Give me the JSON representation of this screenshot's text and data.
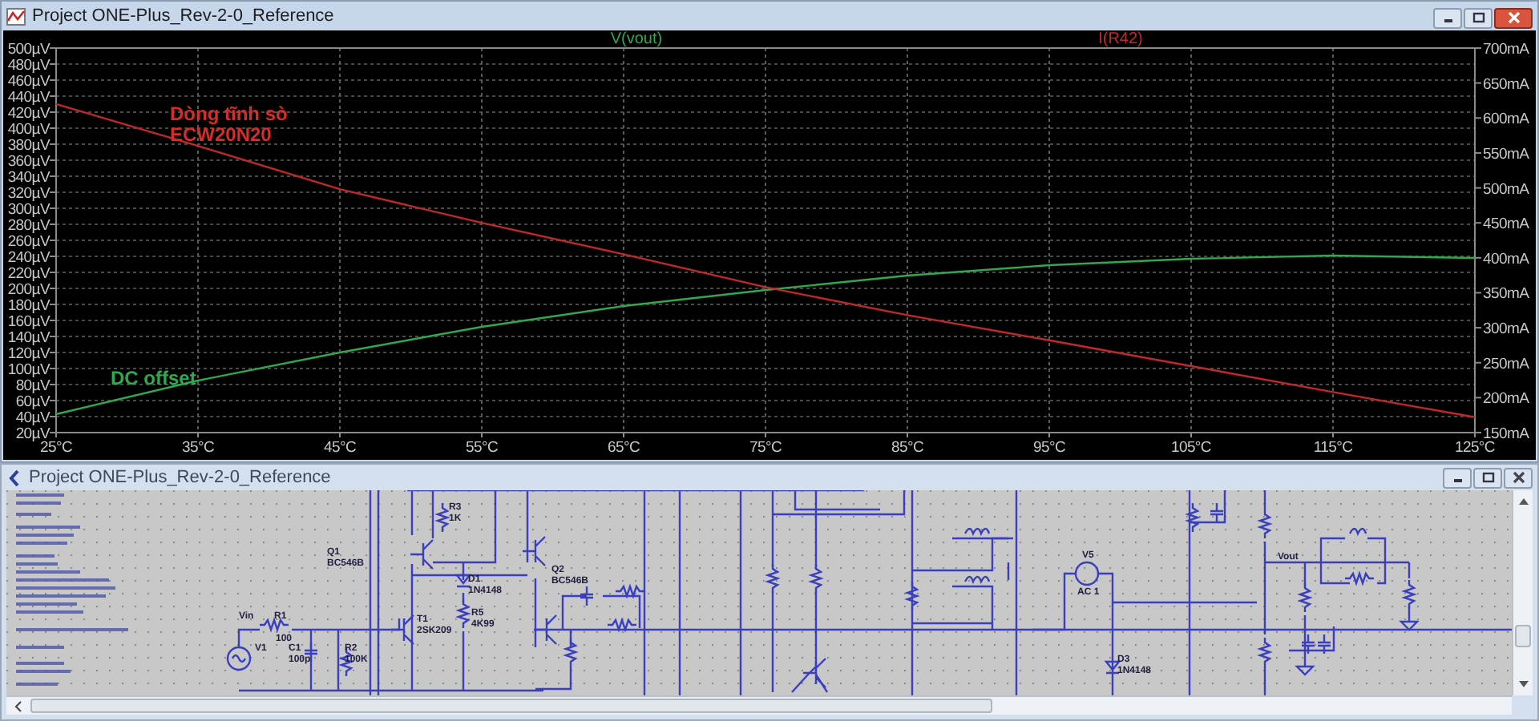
{
  "waveform_window": {
    "title": "Project ONE-Plus_Rev-2-0_Reference",
    "active": true,
    "chart_data": {
      "type": "line",
      "x": [
        25,
        35,
        45,
        55,
        65,
        75,
        85,
        95,
        105,
        115,
        125
      ],
      "series": [
        {
          "name": "V(vout)",
          "color": "#2fa84f",
          "values": [
            43,
            85,
            120,
            152,
            178,
            198,
            216,
            229,
            237,
            241,
            238
          ]
        },
        {
          "name": "I(R42)",
          "color": "#c0282a",
          "axis": "y2",
          "values": [
            620,
            560,
            498,
            450,
            405,
            358,
            318,
            282,
            245,
            208,
            172
          ]
        }
      ],
      "grid": true,
      "xlim": [
        25,
        125
      ],
      "ylim": [
        20,
        500
      ],
      "y2lim": [
        150,
        700
      ],
      "xticks": [
        {
          "value": 25,
          "label": "25°C"
        },
        {
          "value": 35,
          "label": "35°C"
        },
        {
          "value": 45,
          "label": "45°C"
        },
        {
          "value": 55,
          "label": "55°C"
        },
        {
          "value": 65,
          "label": "65°C"
        },
        {
          "value": 75,
          "label": "75°C"
        },
        {
          "value": 85,
          "label": "85°C"
        },
        {
          "value": 95,
          "label": "95°C"
        },
        {
          "value": 105,
          "label": "105°C"
        },
        {
          "value": 115,
          "label": "115°C"
        },
        {
          "value": 125,
          "label": "125°C"
        }
      ],
      "yticks": [
        {
          "value": 20,
          "label": "20µV"
        },
        {
          "value": 40,
          "label": "40µV"
        },
        {
          "value": 60,
          "label": "60µV"
        },
        {
          "value": 80,
          "label": "80µV"
        },
        {
          "value": 100,
          "label": "100µV"
        },
        {
          "value": 120,
          "label": "120µV"
        },
        {
          "value": 140,
          "label": "140µV"
        },
        {
          "value": 160,
          "label": "160µV"
        },
        {
          "value": 180,
          "label": "180µV"
        },
        {
          "value": 200,
          "label": "200µV"
        },
        {
          "value": 220,
          "label": "220µV"
        },
        {
          "value": 240,
          "label": "240µV"
        },
        {
          "value": 260,
          "label": "260µV"
        },
        {
          "value": 280,
          "label": "280µV"
        },
        {
          "value": 300,
          "label": "300µV"
        },
        {
          "value": 320,
          "label": "320µV"
        },
        {
          "value": 340,
          "label": "340µV"
        },
        {
          "value": 360,
          "label": "360µV"
        },
        {
          "value": 380,
          "label": "380µV"
        },
        {
          "value": 400,
          "label": "400µV"
        },
        {
          "value": 420,
          "label": "420µV"
        },
        {
          "value": 440,
          "label": "440µV"
        },
        {
          "value": 460,
          "label": "460µV"
        },
        {
          "value": 480,
          "label": "480µV"
        },
        {
          "value": 500,
          "label": "500µV"
        }
      ],
      "y2ticks": [
        {
          "value": 150,
          "label": "150mA"
        },
        {
          "value": 200,
          "label": "200mA"
        },
        {
          "value": 250,
          "label": "250mA"
        },
        {
          "value": 300,
          "label": "300mA"
        },
        {
          "value": 350,
          "label": "350mA"
        },
        {
          "value": 400,
          "label": "400mA"
        },
        {
          "value": 450,
          "label": "450mA"
        },
        {
          "value": 500,
          "label": "500mA"
        },
        {
          "value": 550,
          "label": "550mA"
        },
        {
          "value": 600,
          "label": "600mA"
        },
        {
          "value": 650,
          "label": "650mA"
        },
        {
          "value": 700,
          "label": "700mA"
        }
      ],
      "annotations": [
        "Dòng tĩnh sò",
        "ECW20N20",
        "DC offset"
      ]
    }
  },
  "schematic_window": {
    "title": "Project ONE-Plus_Rev-2-0_Reference",
    "active": false,
    "labels": [
      "Vin",
      "V1",
      "R1",
      "100",
      "C1",
      "100p",
      "R2",
      "100K",
      "T1",
      "2SK209",
      "Q1",
      "BC546B",
      "R3",
      "1K",
      "D1",
      "1N4148",
      "R5",
      "4K99",
      "Q2",
      "BC546B",
      "V5",
      "AC 1",
      "D3",
      "1N4148",
      "Vout"
    ]
  }
}
